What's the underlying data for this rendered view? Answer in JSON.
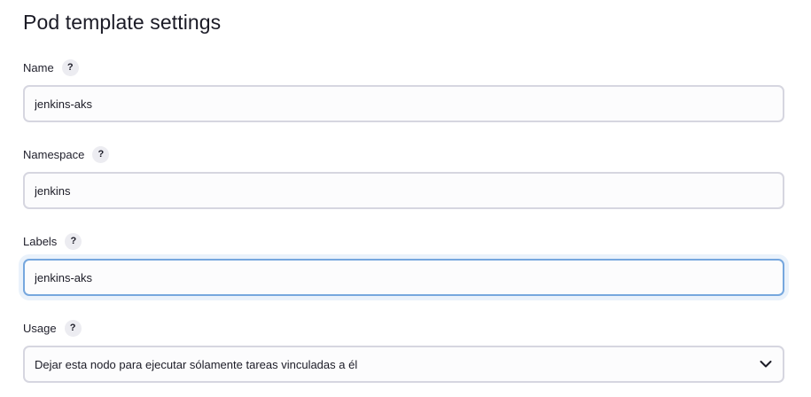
{
  "section": {
    "title": "Pod template settings"
  },
  "fields": {
    "name": {
      "label": "Name",
      "help": "?",
      "value": "jenkins-aks"
    },
    "namespace": {
      "label": "Namespace",
      "help": "?",
      "value": "jenkins"
    },
    "labels": {
      "label": "Labels",
      "help": "?",
      "value": "jenkins-aks"
    },
    "usage": {
      "label": "Usage",
      "help": "?",
      "selected": "Dejar esta nodo para ejecutar sólamente tareas vinculadas a él"
    }
  },
  "colors": {
    "focus_border": "#76a7de",
    "input_border": "#d6d6e0",
    "help_bg": "#ececf1"
  },
  "icons": {
    "help": "question-mark-icon",
    "dropdown": "chevron-down-icon"
  }
}
